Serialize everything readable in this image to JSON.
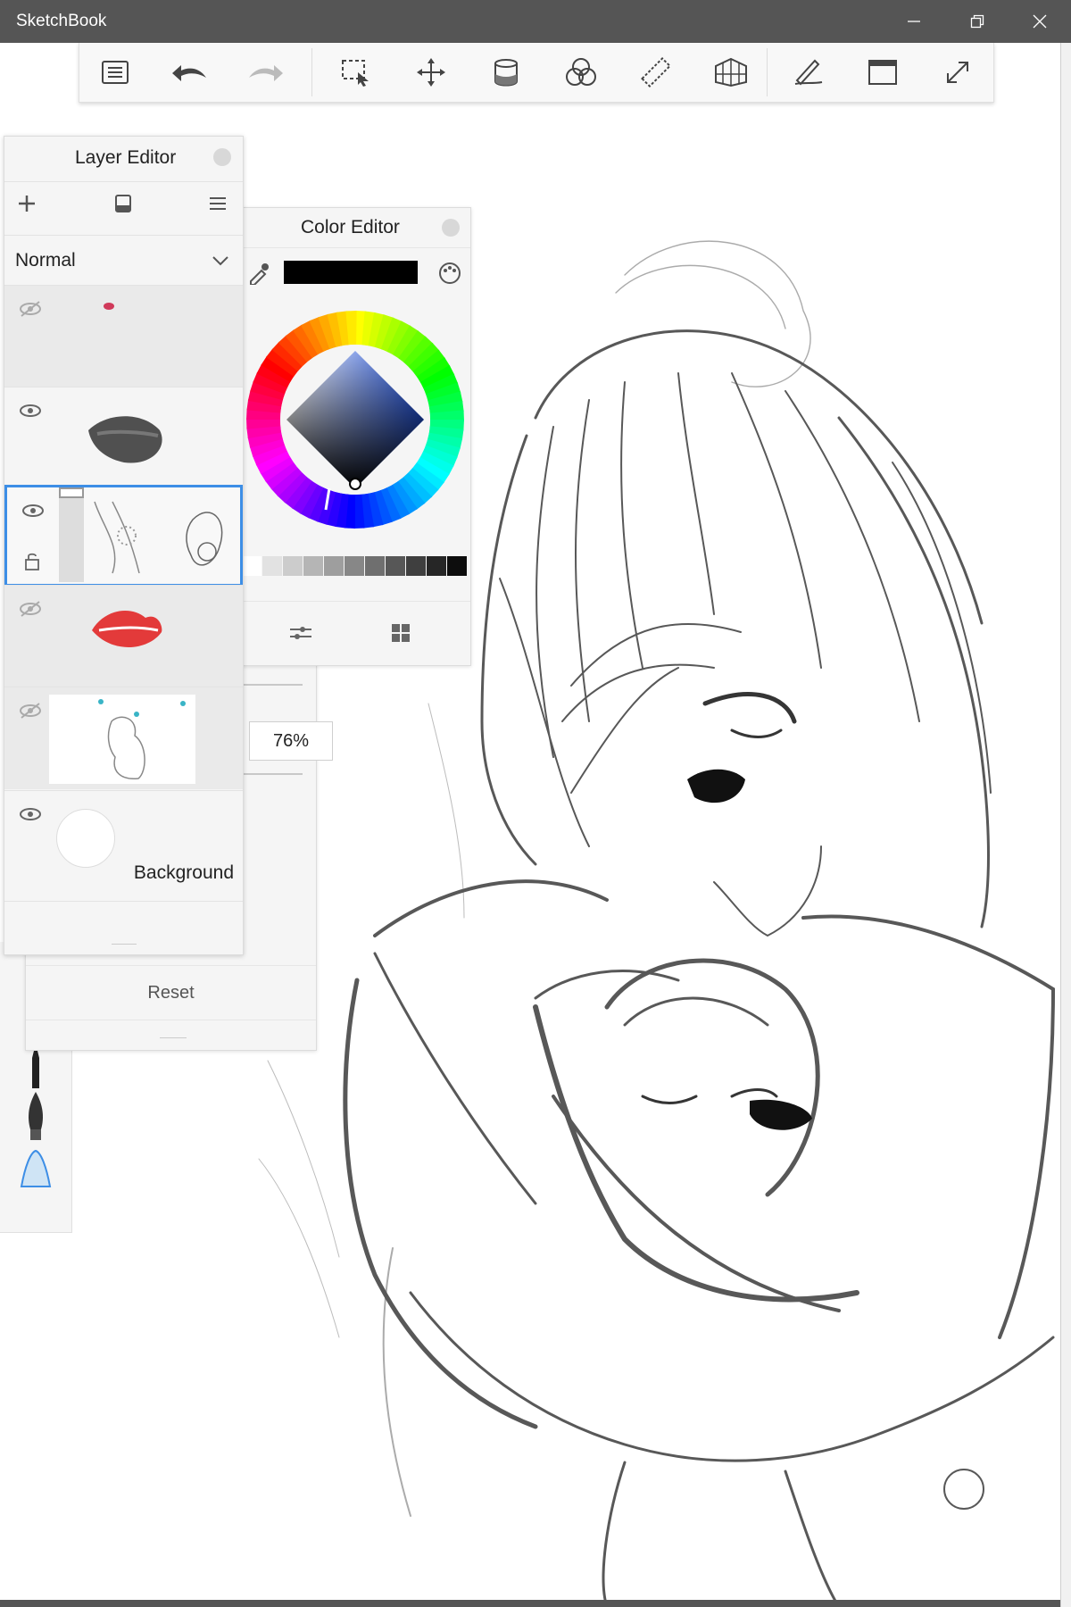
{
  "window": {
    "title": "SketchBook",
    "controls": [
      "minimize",
      "restore",
      "close"
    ]
  },
  "toolbar": {
    "tools": [
      {
        "name": "menu-icon"
      },
      {
        "name": "undo-icon"
      },
      {
        "name": "redo-icon"
      },
      {
        "name": "selection-icon"
      },
      {
        "name": "transform-move-icon"
      },
      {
        "name": "fill-bucket-icon"
      },
      {
        "name": "color-circles-icon"
      },
      {
        "name": "ruler-icon"
      },
      {
        "name": "perspective-grid-icon"
      },
      {
        "name": "pen-stroke-icon"
      },
      {
        "name": "window-icon"
      },
      {
        "name": "fullscreen-icon"
      }
    ]
  },
  "layer_editor": {
    "title": "Layer Editor",
    "blend_mode": "Normal",
    "layers": [
      {
        "visible": false,
        "thumbnail": "small-pink-lips"
      },
      {
        "visible": true,
        "thumbnail": "dark-lips-sketch"
      },
      {
        "visible": true,
        "selected": true,
        "thumbnail": "figure-sketch"
      },
      {
        "visible": false,
        "thumbnail": "red-lips"
      },
      {
        "visible": false,
        "thumbnail": "full-drawing"
      },
      {
        "visible": true,
        "thumbnail": "white-background",
        "label": "Background"
      }
    ]
  },
  "color_editor": {
    "title": "Color Editor",
    "current_color": "#000000",
    "gray_swatches": [
      "#ffffff",
      "#e2e2e2",
      "#cccccc",
      "#b5b5b5",
      "#9e9e9e",
      "#878787",
      "#6f6f6f",
      "#575757",
      "#3f3f3f",
      "#262626",
      "#0d0d0d"
    ]
  },
  "brush_panel": {
    "opacity_value": "76%",
    "reset_label": "Reset"
  },
  "colors": {
    "titlebar": "#555555",
    "selection": "#3d8ee6",
    "panel": "#f5f5f5"
  }
}
